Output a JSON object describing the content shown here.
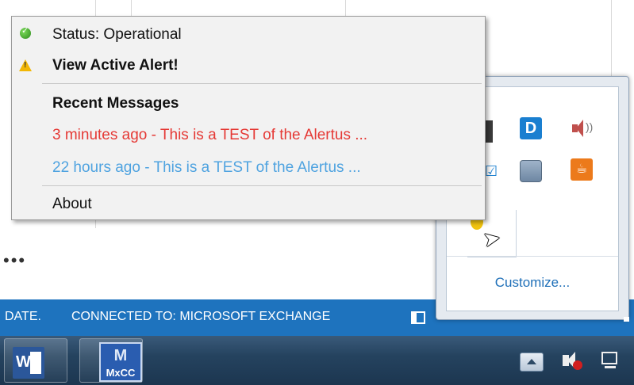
{
  "menu": {
    "status_label": "Status: Operational",
    "view_alert_label": "View Active Alert!",
    "recent_header": "Recent Messages",
    "messages": [
      {
        "text": "3 minutes ago - This is a TEST of the Alertus ...",
        "color": "#e53935"
      },
      {
        "text": "22 hours ago - This is a TEST of the Alertus ...",
        "color": "#4fa3e0"
      }
    ],
    "about_label": "About"
  },
  "statusbar": {
    "left_text": "DATE.",
    "connection_text": "CONNECTED TO: MICROSOFT EXCHANGE"
  },
  "tray_flyout": {
    "customize_label": "Customize..."
  },
  "taskbar": {
    "mxcc_label": "MxCC"
  },
  "background": {
    "ellipsis": "•••"
  },
  "colors": {
    "statusbar": "#1e73be",
    "accent_link": "#1e6fb8",
    "alert_recent": "#e53935",
    "alert_old": "#4fa3e0"
  }
}
